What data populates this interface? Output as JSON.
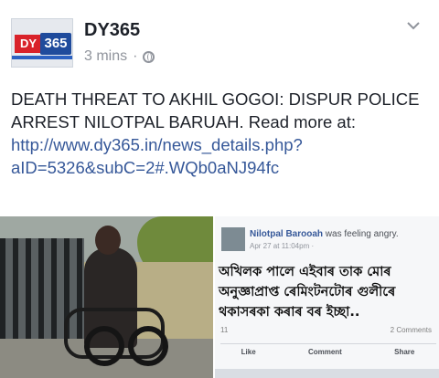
{
  "post": {
    "page_name": "DY365",
    "time": "3 mins",
    "separator": "·",
    "avatar_text_left": "DY",
    "avatar_text_right": "365",
    "text": "DEATH THREAT TO AKHIL GOGOI: DISPUR POLICE ARREST NILOTPAL BARUAH. Read more at: ",
    "link": "http://www.dy365.in/news_details.php?aID=5326&subC=2#.WQb0aNJ94fc",
    "privacy_icon": "globe-icon",
    "menu_icon": "chevron-down-icon"
  },
  "embedded_screenshot": {
    "name": "Nilotpal Barooah",
    "status": " was  feeling angry.",
    "date": "Apr 27 at 11:04pm · ",
    "text": "অখিলক পালে এইবাৰ তাক মোৰ অনুজ্ঞাপ্ৰাপ্ত ৰেমিংটনটোৰ গুলীৰে থকাসৰকা কৰাৰ বৰ ইচ্ছা..",
    "likes": "11",
    "comments": "2 Comments",
    "actions": [
      "Like",
      "Comment",
      "Share"
    ]
  }
}
